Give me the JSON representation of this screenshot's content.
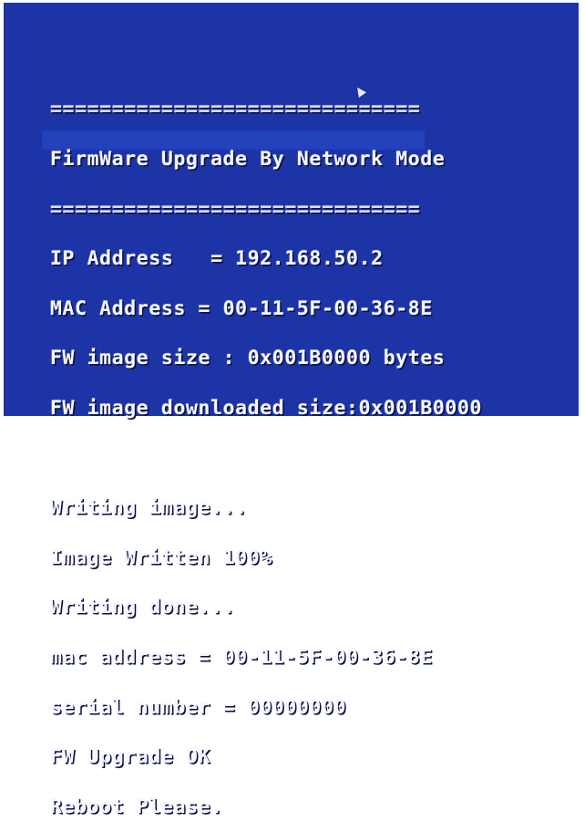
{
  "console": {
    "separator_top": "==============================",
    "title": "FirmWare Upgrade By Network Mode",
    "separator_bottom": "==============================",
    "ip_address": "IP Address   = 192.168.50.2",
    "mac_address": "MAC Address = 00-11-5F-00-36-8E",
    "fw_image_size": "FW image size : 0x001B0000 bytes",
    "fw_downloaded_size": "FW image downloaded size:0x001B0000",
    "writing_image": "Writing image...",
    "image_written": "Image Written 100%",
    "writing_done": "Writing done...",
    "mac_address_lower": "mac address = 00-11-5F-00-36-8E",
    "serial_number": "serial number = 00000000",
    "fw_upgrade_ok": "FW Upgrade OK",
    "reboot": "Reboot Please."
  },
  "colors": {
    "background": "#1c34a6",
    "text": "#f4f6ff"
  }
}
